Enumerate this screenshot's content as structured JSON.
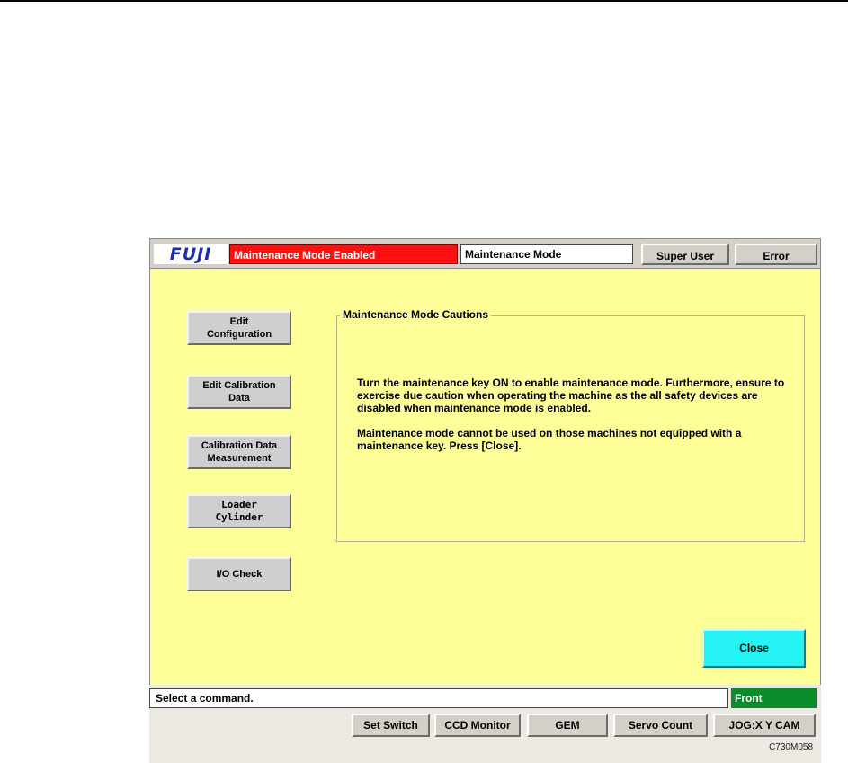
{
  "header": {
    "logo": "FUJI",
    "mode_banner": "Maintenance Mode Enabled",
    "mode_field": "Maintenance Mode",
    "super_user_label": "Super User",
    "error_label": "Error"
  },
  "side_buttons": [
    {
      "label": "Edit\nConfiguration"
    },
    {
      "label": "Edit Calibration\nData"
    },
    {
      "label": "Calibration Data\nMeasurement"
    },
    {
      "label": "Loader\nCylinder"
    },
    {
      "label": "I/O Check"
    }
  ],
  "caution": {
    "title": "Maintenance Mode Cautions",
    "paragraph1": "Turn the maintenance key ON to enable maintenance mode. Furthermore, ensure to exercise due caution when operating the machine as the all safety devices are disabled when maintenance mode is enabled.",
    "paragraph2": "Maintenance mode cannot be used on those machines not equipped with a maintenance key. Press [Close]."
  },
  "close_label": "Close",
  "status": {
    "message": "Select a command.",
    "position": "Front"
  },
  "footer_buttons": [
    {
      "label": "Set Switch"
    },
    {
      "label": "CCD Monitor"
    },
    {
      "label": "GEM"
    },
    {
      "label": "Servo Count"
    },
    {
      "label": "JOG:X Y CAM"
    }
  ],
  "image_code": "C730M058",
  "colors": {
    "panel": "#ffff99",
    "banner": "#ff1010",
    "close_button": "#25f2f2",
    "front_indicator": "#0b8c2c",
    "logo_text": "#1a2fb5"
  }
}
